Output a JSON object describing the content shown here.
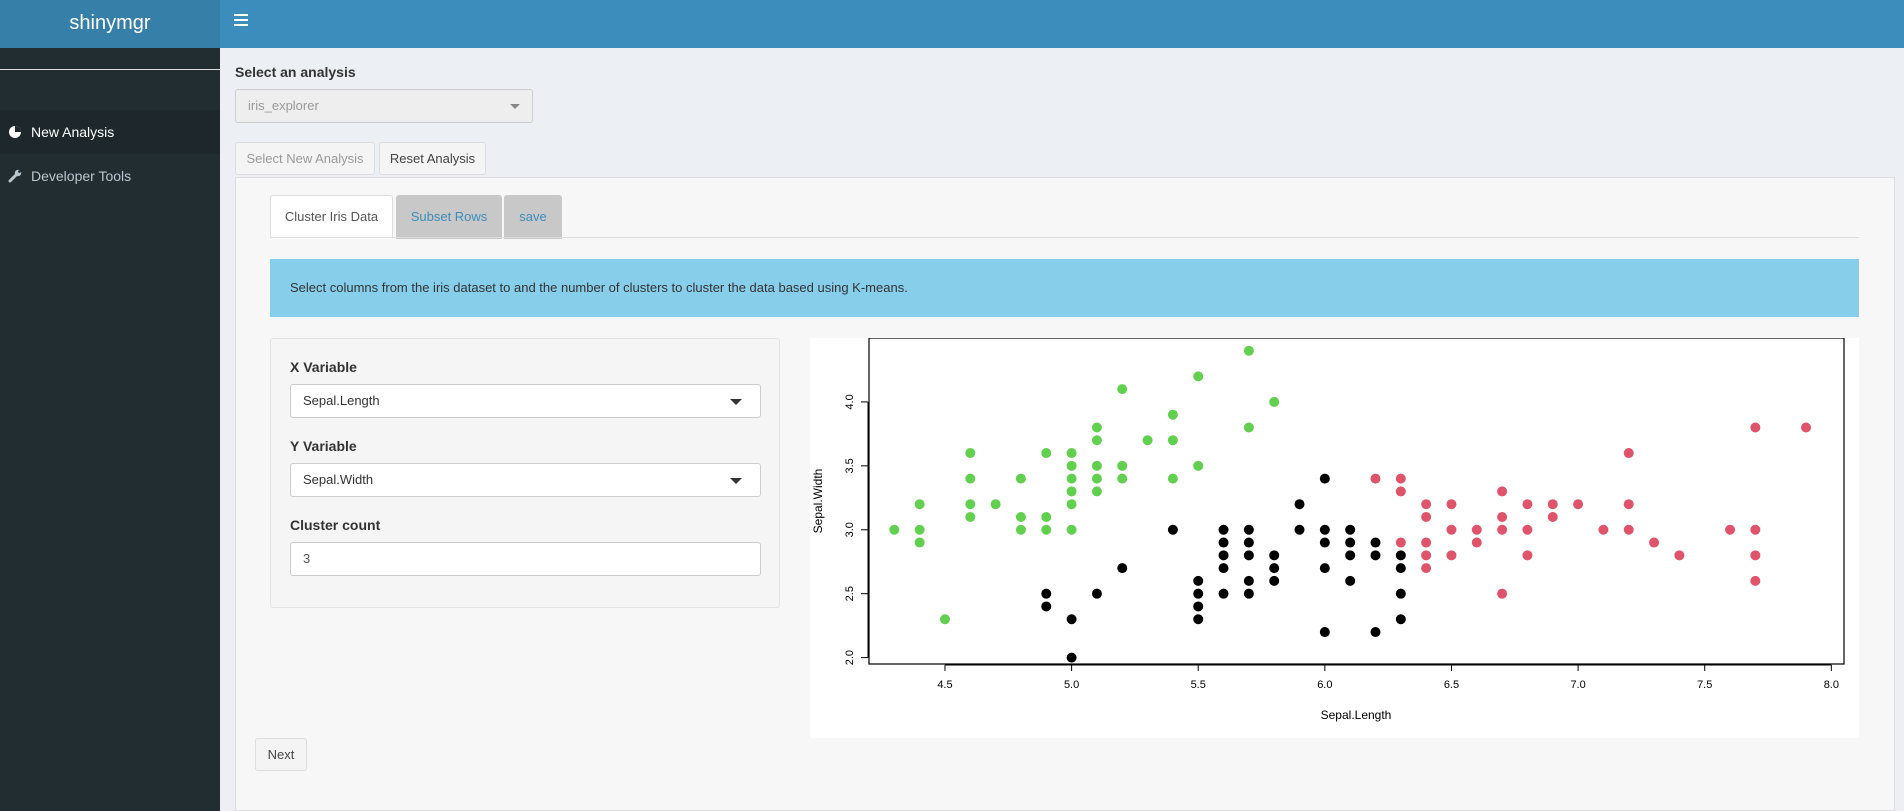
{
  "app": {
    "title": "shinymgr"
  },
  "sidebar": {
    "items": [
      {
        "label": "New Analysis",
        "icon": "pie-chart-icon"
      },
      {
        "label": "Developer Tools",
        "icon": "wrench-icon"
      }
    ]
  },
  "main": {
    "select_label": "Select an analysis",
    "select_value": "iris_explorer",
    "select_new_button": "Select New Analysis",
    "reset_button": "Reset Analysis",
    "tabs": [
      {
        "label": "Cluster Iris Data"
      },
      {
        "label": "Subset Rows"
      },
      {
        "label": "save"
      }
    ],
    "info_text": "Select columns from the iris dataset to and the number of clusters to cluster the data based using K-means.",
    "form": {
      "x_label": "X Variable",
      "x_value": "Sepal.Length",
      "y_label": "Y Variable",
      "y_value": "Sepal.Width",
      "cluster_label": "Cluster count",
      "cluster_value": "3"
    },
    "next_button": "Next"
  },
  "colors": {
    "cluster_1": "#000000",
    "cluster_2": "#df536b",
    "cluster_3": "#61d04f",
    "header": "#3c8dbc",
    "sidebar": "#222d32",
    "info": "#87ceeb"
  },
  "chart_data": {
    "type": "scatter",
    "xlabel": "Sepal.Length",
    "ylabel": "Sepal.Width",
    "xlim": [
      4.2,
      8.05
    ],
    "ylim": [
      1.95,
      4.5
    ],
    "xticks": [
      "4.5",
      "5.0",
      "5.5",
      "6.0",
      "6.5",
      "7.0",
      "7.5",
      "8.0"
    ],
    "yticks": [
      "2.0",
      "2.5",
      "3.0",
      "3.5",
      "4.0"
    ],
    "series": [
      {
        "color": "#61d04f",
        "points": [
          [
            4.3,
            3.0
          ],
          [
            4.4,
            3.2
          ],
          [
            4.4,
            3.0
          ],
          [
            4.4,
            2.9
          ],
          [
            4.5,
            2.3
          ],
          [
            4.6,
            3.6
          ],
          [
            4.6,
            3.4
          ],
          [
            4.6,
            3.2
          ],
          [
            4.6,
            3.1
          ],
          [
            4.7,
            3.2
          ],
          [
            4.8,
            3.4
          ],
          [
            4.8,
            3.1
          ],
          [
            4.8,
            3.0
          ],
          [
            4.9,
            3.6
          ],
          [
            4.9,
            3.1
          ],
          [
            4.9,
            3.0
          ],
          [
            5.0,
            3.6
          ],
          [
            5.0,
            3.5
          ],
          [
            5.0,
            3.4
          ],
          [
            5.0,
            3.3
          ],
          [
            5.0,
            3.2
          ],
          [
            5.0,
            3.0
          ],
          [
            5.1,
            3.8
          ],
          [
            5.1,
            3.7
          ],
          [
            5.1,
            3.5
          ],
          [
            5.1,
            3.4
          ],
          [
            5.1,
            3.3
          ],
          [
            5.2,
            4.1
          ],
          [
            5.2,
            3.5
          ],
          [
            5.2,
            3.4
          ],
          [
            5.3,
            3.7
          ],
          [
            5.4,
            3.9
          ],
          [
            5.4,
            3.7
          ],
          [
            5.4,
            3.4
          ],
          [
            5.5,
            4.2
          ],
          [
            5.5,
            3.5
          ],
          [
            5.7,
            4.4
          ],
          [
            5.7,
            3.8
          ],
          [
            5.8,
            4.0
          ]
        ]
      },
      {
        "color": "#000000",
        "points": [
          [
            4.9,
            2.5
          ],
          [
            4.9,
            2.4
          ],
          [
            5.0,
            2.3
          ],
          [
            5.0,
            2.0
          ],
          [
            5.1,
            2.5
          ],
          [
            5.2,
            2.7
          ],
          [
            5.4,
            3.0
          ],
          [
            5.5,
            2.6
          ],
          [
            5.5,
            2.5
          ],
          [
            5.5,
            2.4
          ],
          [
            5.5,
            2.3
          ],
          [
            5.6,
            3.0
          ],
          [
            5.6,
            2.9
          ],
          [
            5.6,
            2.8
          ],
          [
            5.6,
            2.7
          ],
          [
            5.6,
            2.5
          ],
          [
            5.7,
            3.0
          ],
          [
            5.7,
            2.9
          ],
          [
            5.7,
            2.8
          ],
          [
            5.7,
            2.6
          ],
          [
            5.7,
            2.5
          ],
          [
            5.8,
            2.8
          ],
          [
            5.8,
            2.7
          ],
          [
            5.8,
            2.6
          ],
          [
            5.9,
            3.2
          ],
          [
            5.9,
            3.0
          ],
          [
            6.0,
            3.4
          ],
          [
            6.0,
            3.0
          ],
          [
            6.0,
            2.9
          ],
          [
            6.0,
            2.7
          ],
          [
            6.0,
            2.2
          ],
          [
            6.1,
            3.0
          ],
          [
            6.1,
            2.9
          ],
          [
            6.1,
            2.8
          ],
          [
            6.1,
            2.6
          ],
          [
            6.2,
            2.9
          ],
          [
            6.2,
            2.8
          ],
          [
            6.2,
            2.2
          ],
          [
            6.3,
            2.8
          ],
          [
            6.3,
            2.7
          ],
          [
            6.3,
            2.5
          ],
          [
            6.3,
            2.3
          ]
        ]
      },
      {
        "color": "#df536b",
        "points": [
          [
            6.2,
            3.4
          ],
          [
            6.3,
            3.4
          ],
          [
            6.3,
            3.3
          ],
          [
            6.3,
            2.9
          ],
          [
            6.4,
            3.2
          ],
          [
            6.4,
            3.1
          ],
          [
            6.4,
            2.9
          ],
          [
            6.4,
            2.8
          ],
          [
            6.4,
            2.7
          ],
          [
            6.5,
            3.2
          ],
          [
            6.5,
            3.0
          ],
          [
            6.5,
            2.8
          ],
          [
            6.6,
            3.0
          ],
          [
            6.6,
            2.9
          ],
          [
            6.7,
            3.3
          ],
          [
            6.7,
            3.1
          ],
          [
            6.7,
            3.0
          ],
          [
            6.7,
            2.5
          ],
          [
            6.8,
            3.2
          ],
          [
            6.8,
            3.0
          ],
          [
            6.8,
            2.8
          ],
          [
            6.9,
            3.2
          ],
          [
            6.9,
            3.1
          ],
          [
            7.0,
            3.2
          ],
          [
            7.1,
            3.0
          ],
          [
            7.2,
            3.6
          ],
          [
            7.2,
            3.2
          ],
          [
            7.2,
            3.0
          ],
          [
            7.3,
            2.9
          ],
          [
            7.4,
            2.8
          ],
          [
            7.6,
            3.0
          ],
          [
            7.7,
            3.8
          ],
          [
            7.7,
            3.0
          ],
          [
            7.7,
            2.8
          ],
          [
            7.7,
            2.6
          ],
          [
            7.9,
            3.8
          ]
        ]
      }
    ]
  }
}
